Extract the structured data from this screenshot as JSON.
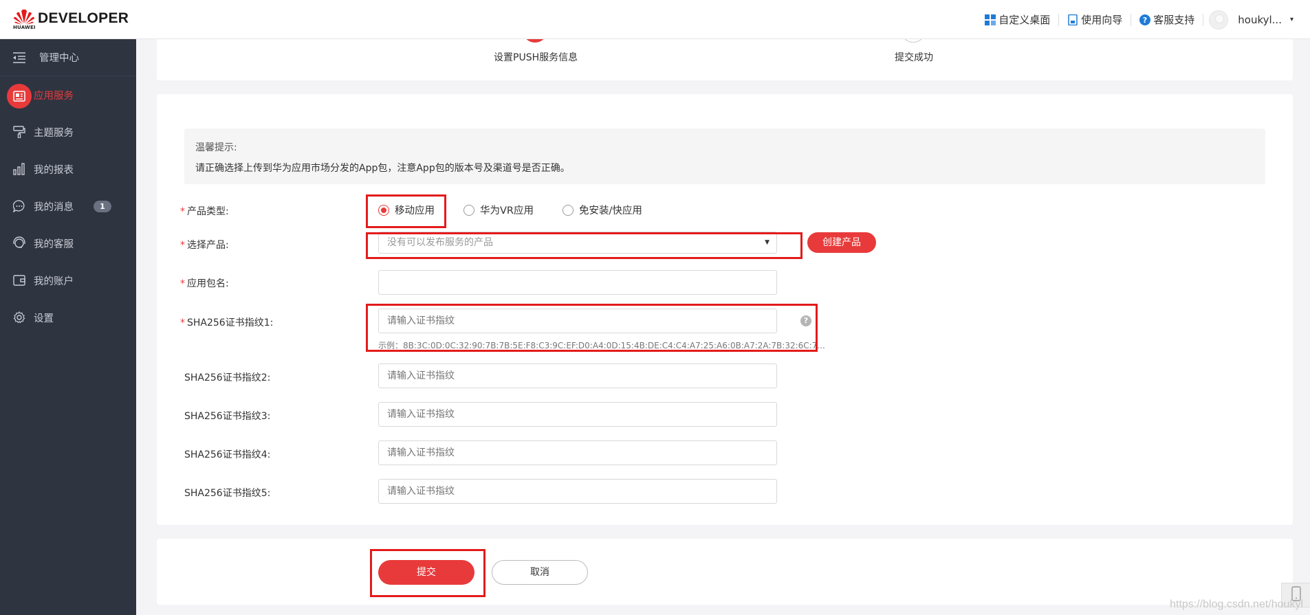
{
  "header": {
    "logo_text": "DEVELOPER",
    "logo_small": "HUAWEI",
    "links": [
      {
        "label": "自定义桌面",
        "icon": "grid-icon"
      },
      {
        "label": "使用向导",
        "icon": "document-icon"
      },
      {
        "label": "客服支持",
        "icon": "help-icon"
      }
    ],
    "user_name": "houkyl...",
    "caret": "▾"
  },
  "sidebar": {
    "items": [
      {
        "label": "管理中心",
        "icon": "menu-collapse-icon"
      },
      {
        "label": "应用服务",
        "icon": "app-card-icon",
        "active": true
      },
      {
        "label": "主题服务",
        "icon": "paint-roller-icon"
      },
      {
        "label": "我的报表",
        "icon": "bar-chart-icon"
      },
      {
        "label": "我的消息",
        "icon": "chat-icon",
        "badge": "1"
      },
      {
        "label": "我的客服",
        "icon": "headset-icon"
      },
      {
        "label": "我的账户",
        "icon": "wallet-icon"
      },
      {
        "label": "设置",
        "icon": "gear-icon"
      }
    ]
  },
  "steps": [
    {
      "label": "设置PUSH服务信息",
      "state": "active"
    },
    {
      "label": "提交成功",
      "state": "pending"
    }
  ],
  "tip": {
    "title": "温馨提示:",
    "text": "请正确选择上传到华为应用市场分发的App包，注意App包的版本号及渠道号是否正确。"
  },
  "form": {
    "product_type": {
      "label": "产品类型:",
      "options": [
        "移动应用",
        "华为VR应用",
        "免安装/快应用"
      ],
      "selected": "移动应用"
    },
    "product": {
      "label": "选择产品:",
      "placeholder": "没有可以发布服务的产品",
      "create_label": "创建产品"
    },
    "package_name": {
      "label": "应用包名:",
      "value": ""
    },
    "sha": [
      {
        "label": "SHA256证书指纹1:",
        "placeholder": "请输入证书指纹",
        "required": true
      },
      {
        "label": "SHA256证书指纹2:",
        "placeholder": "请输入证书指纹",
        "required": false
      },
      {
        "label": "SHA256证书指纹3:",
        "placeholder": "请输入证书指纹",
        "required": false
      },
      {
        "label": "SHA256证书指纹4:",
        "placeholder": "请输入证书指纹",
        "required": false
      },
      {
        "label": "SHA256证书指纹5:",
        "placeholder": "请输入证书指纹",
        "required": false
      }
    ],
    "sha_example": "示例：8B:3C:0D:0C:32:90:7B:7B:5E:F8:C3:9C:EF:D0:A4:0D:15:4B:DE:C4:C4:A7:25:A6:0B:A7:2A:7B:32:6C:7...",
    "help_symbol": "?",
    "required_mark": "*"
  },
  "actions": {
    "submit": "提交",
    "cancel": "取消"
  },
  "watermark": "https://blog.csdn.net/houkyl",
  "colors": {
    "accent": "#e83a3a",
    "sidebar_bg": "#2f3441",
    "highlight_box": "#e31b1b"
  }
}
